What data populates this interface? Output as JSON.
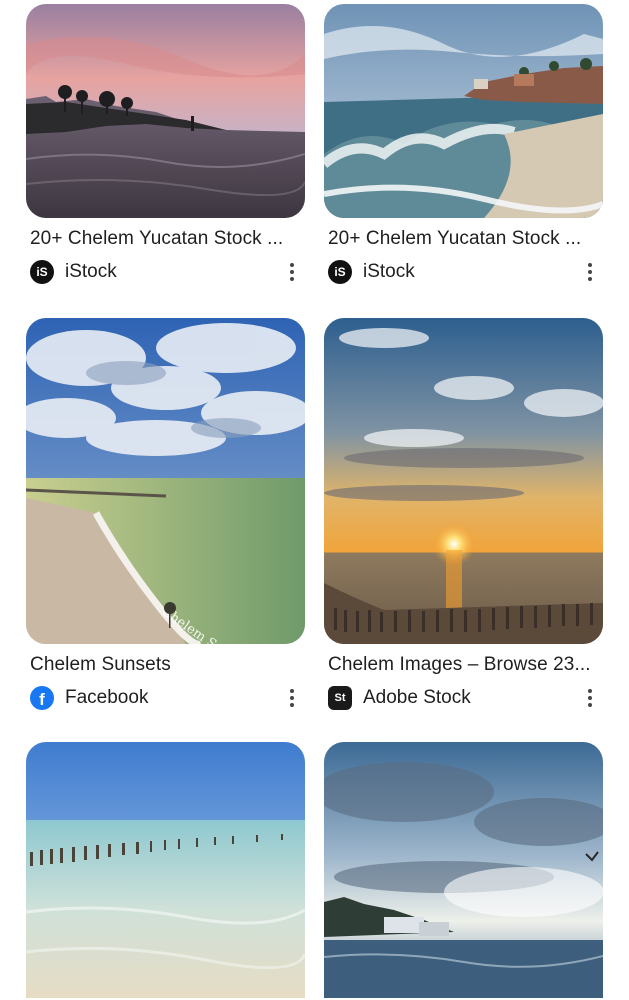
{
  "results": [
    {
      "title": "20+ Chelem Yucatan Stock ...",
      "source": "iStock",
      "source_icon": "istock-logo-icon"
    },
    {
      "title": "20+ Chelem Yucatan Stock ...",
      "source": "iStock",
      "source_icon": "istock-logo-icon"
    },
    {
      "title": "Chelem Sunsets",
      "source": "Facebook",
      "source_icon": "facebook-logo-icon",
      "watermark": "Chelem Sunsets"
    },
    {
      "title": "Chelem Images – Browse 23...",
      "source": "Adobe Stock",
      "source_icon": "adobe-stock-logo-icon"
    }
  ],
  "logos": {
    "istock": "iS",
    "adobe_stock": "St",
    "facebook": "f"
  },
  "colors": {
    "text": "#1f1f1f",
    "facebook": "#1877f2",
    "istock": "#111111",
    "adobe_stock": "#1a1a1a",
    "more_icon": "#444746"
  }
}
